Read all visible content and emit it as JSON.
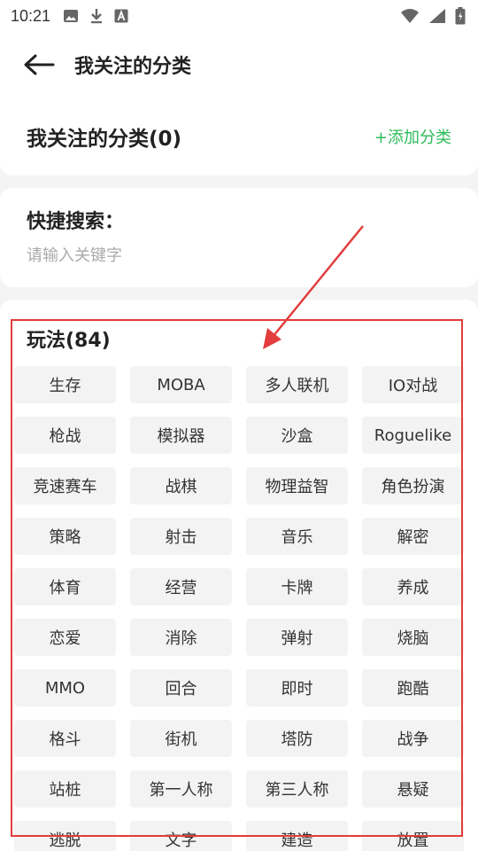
{
  "status_bar": {
    "time": "10:21",
    "left_icons": [
      "image-icon",
      "download-icon",
      "font-a-icon"
    ],
    "right_icons": [
      "wifi-icon",
      "signal-icon",
      "battery-icon"
    ]
  },
  "header": {
    "back_icon": "arrow-left-icon",
    "title": "我关注的分类"
  },
  "followed": {
    "title": "我关注的分类(0)",
    "add_label": "+添加分类",
    "accent_color": "#2dbb5a"
  },
  "search": {
    "label": "快捷搜索：",
    "value": "",
    "placeholder": "请输入关键字"
  },
  "gameplay": {
    "title": "玩法(84)",
    "tags": [
      "生存",
      "MOBA",
      "多人联机",
      "IO对战",
      "枪战",
      "模拟器",
      "沙盒",
      "Roguelike",
      "竞速赛车",
      "战棋",
      "物理益智",
      "角色扮演",
      "策略",
      "射击",
      "音乐",
      "解密",
      "体育",
      "经营",
      "卡牌",
      "养成",
      "恋爱",
      "消除",
      "弹射",
      "烧脑",
      "MMO",
      "回合",
      "即时",
      "跑酷",
      "格斗",
      "街机",
      "塔防",
      "战争",
      "站桩",
      "第一人称",
      "第三人称",
      "悬疑",
      "逃脱",
      "文字",
      "建造",
      "放置"
    ]
  },
  "annotation": {
    "color": "#e23c3c"
  }
}
